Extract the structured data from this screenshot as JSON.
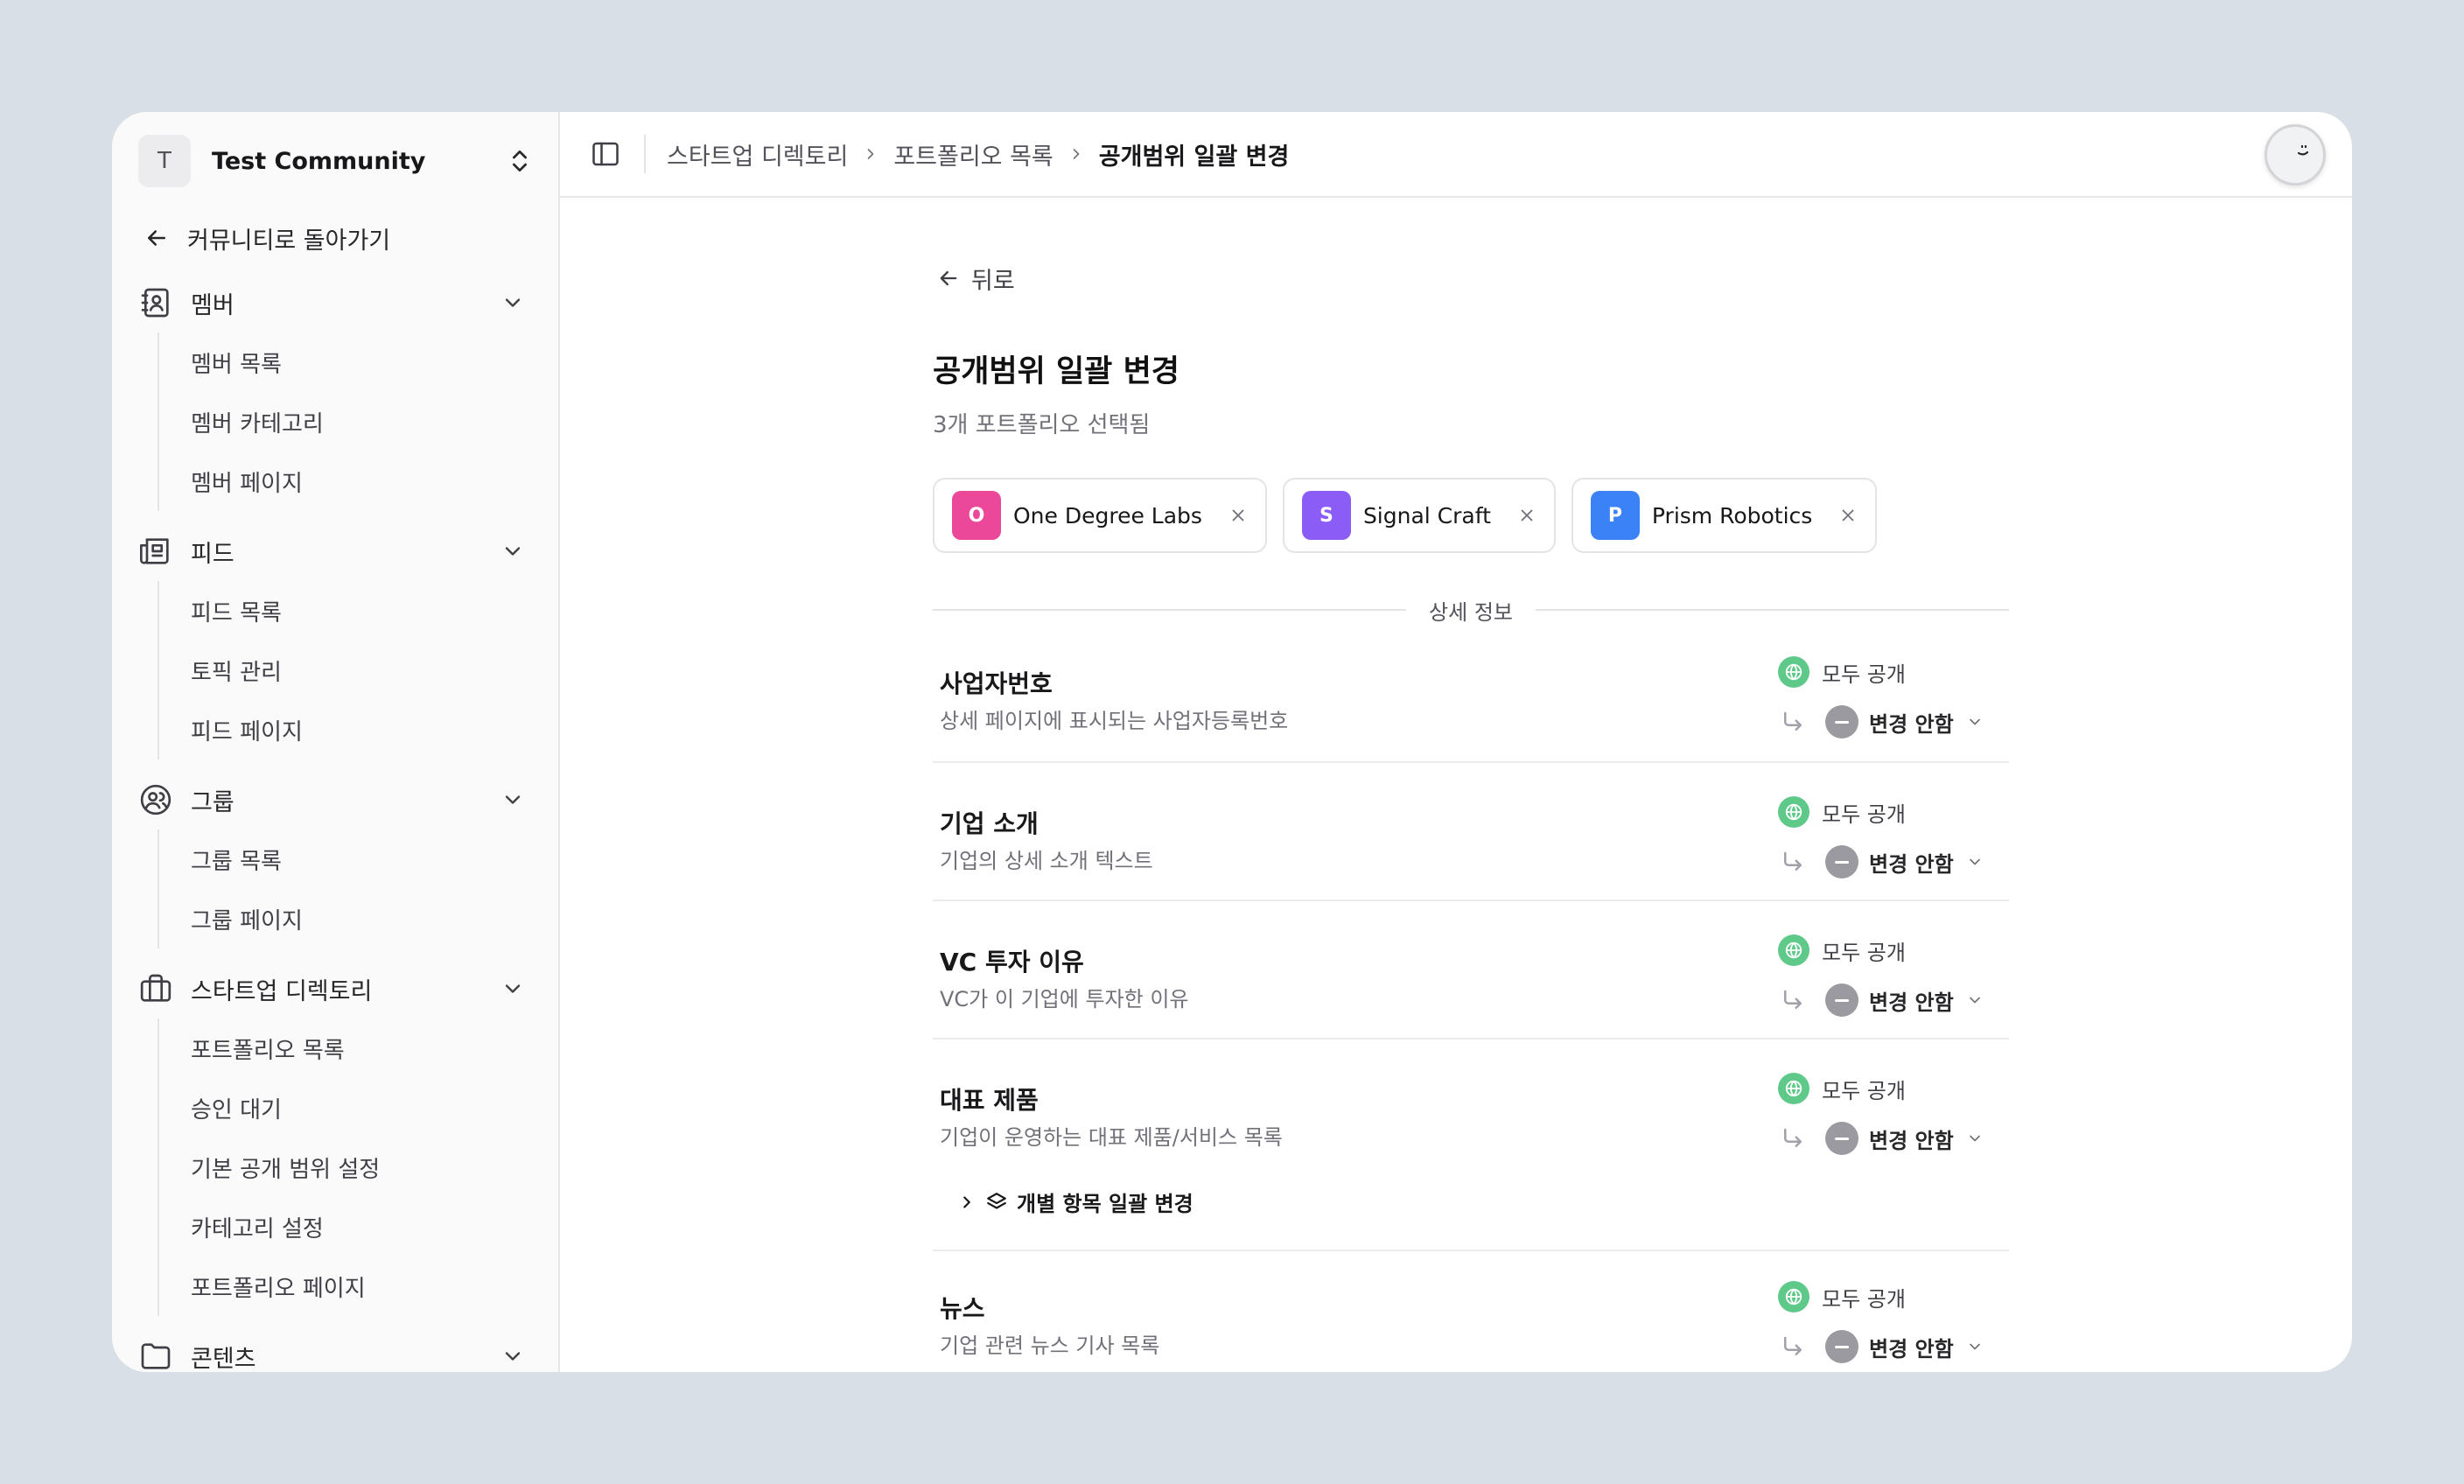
{
  "workspace": {
    "initial": "T",
    "name": "Test Community"
  },
  "sidebar": {
    "back_label": "커뮤니티로 돌아가기",
    "sections": [
      {
        "label": "멤버",
        "icon": "contact-card-icon",
        "items": [
          "멤버 목록",
          "멤버 카테고리",
          "멤버 페이지"
        ]
      },
      {
        "label": "피드",
        "icon": "newspaper-icon",
        "items": [
          "피드 목록",
          "토픽 관리",
          "피드 페이지"
        ]
      },
      {
        "label": "그룹",
        "icon": "users-circle-icon",
        "items": [
          "그룹 목록",
          "그룹 페이지"
        ]
      },
      {
        "label": "스타트업 디렉토리",
        "icon": "briefcase-icon",
        "items": [
          "포트폴리오 목록",
          "승인 대기",
          "기본 공개 범위 설정",
          "카테고리 설정",
          "포트폴리오 페이지"
        ]
      },
      {
        "label": "콘텐츠",
        "icon": "folder-icon",
        "items": []
      }
    ]
  },
  "breadcrumb": [
    "스타트업 디렉토리",
    "포트폴리오 목록",
    "공개범위 일괄 변경"
  ],
  "page": {
    "back_label": "뒤로",
    "title": "공개범위 일괄 변경",
    "subtitle": "3개 포트폴리오 선택됨",
    "section_label": "상세 정보"
  },
  "selected": [
    {
      "initial": "O",
      "name": "One Degree Labs",
      "color": "#ec4899"
    },
    {
      "initial": "S",
      "name": "Signal Craft",
      "color": "#8b5cf6"
    },
    {
      "initial": "P",
      "name": "Prism Robotics",
      "color": "#3b82f6"
    }
  ],
  "fields": [
    {
      "name": "사업자번호",
      "desc": "상세 페이지에 표시되는 사업자등록번호",
      "current": "모두 공개",
      "new": "변경 안함"
    },
    {
      "name": "기업 소개",
      "desc": "기업의 상세 소개 텍스트",
      "current": "모두 공개",
      "new": "변경 안함"
    },
    {
      "name": "VC 투자 이유",
      "desc": "VC가 이 기업에 투자한 이유",
      "current": "모두 공개",
      "new": "변경 안함"
    },
    {
      "name": "대표 제품",
      "desc": "기업이 운영하는 대표 제품/서비스 목록",
      "current": "모두 공개",
      "new": "변경 안함",
      "bulk_label": "개별 항목 일괄 변경"
    },
    {
      "name": "뉴스",
      "desc": "기업 관련 뉴스 기사 목록",
      "current": "모두 공개",
      "new": "변경 안함"
    }
  ]
}
